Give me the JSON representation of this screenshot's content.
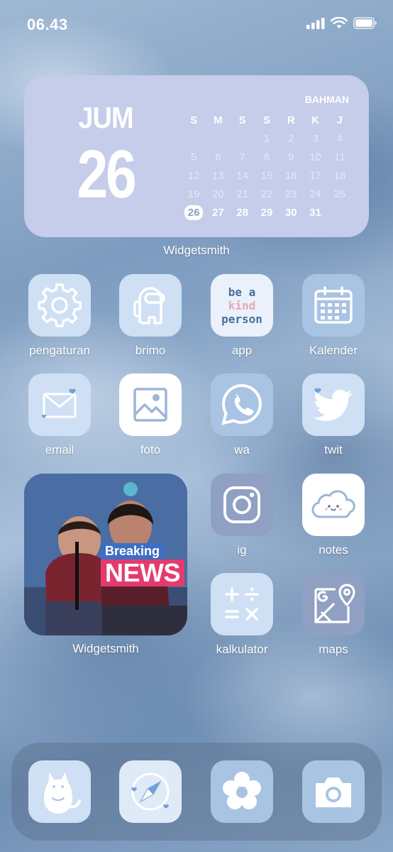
{
  "status_bar": {
    "time": "06.43"
  },
  "calendar_widget": {
    "month_short": "JUM",
    "day": "26",
    "month_name": "BAHMAN",
    "weekdays": [
      "S",
      "M",
      "S",
      "S",
      "R",
      "K",
      "J"
    ],
    "weeks": [
      [
        "",
        "",
        "",
        "1",
        "2",
        "3",
        "4"
      ],
      [
        "5",
        "6",
        "7",
        "8",
        "9",
        "10",
        "11"
      ],
      [
        "12",
        "13",
        "14",
        "15",
        "16",
        "17",
        "18"
      ],
      [
        "19",
        "20",
        "21",
        "22",
        "23",
        "24",
        "25"
      ],
      [
        "26",
        "27",
        "28",
        "29",
        "30",
        "31",
        ""
      ]
    ],
    "today": "26",
    "label": "Widgetsmith"
  },
  "apps": {
    "pengaturan": "pengaturan",
    "brimo": "brimo",
    "app": "app",
    "app_icon_text": [
      "be a",
      "kind",
      "person"
    ],
    "kalender": "Kalender",
    "email": "email",
    "foto": "foto",
    "wa": "wa",
    "twit": "twit",
    "ig": "ig",
    "notes": "notes",
    "kalkulator": "kalkulator",
    "maps": "maps"
  },
  "photo_widget": {
    "banner_top": "Breaking",
    "banner_bottom": "NEWS",
    "label": "Widgetsmith"
  },
  "dock": [
    "cat-icon",
    "safari-icon",
    "flower-icon",
    "camera-icon"
  ],
  "colors": {
    "icon_light": "#cfe0f4",
    "icon_pale": "#dfeaf7",
    "icon_white": "#ffffff",
    "icon_mid": "#a9bfdd",
    "icon_slate": "#8fa0c2",
    "calendar_bg": "#c5cdea",
    "news_blue": "#3e6ec4",
    "news_pink": "#e43b6f"
  }
}
